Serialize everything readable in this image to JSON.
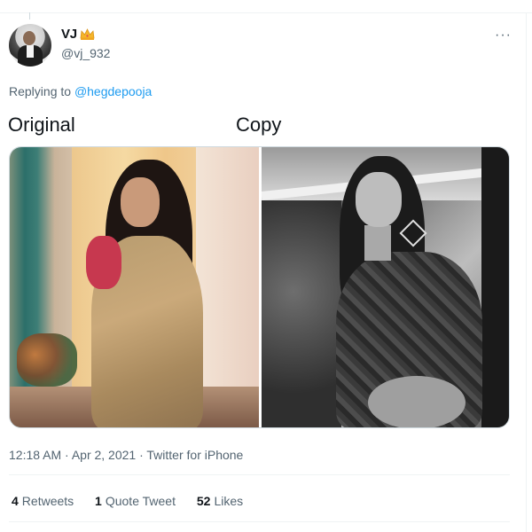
{
  "tweet": {
    "author": {
      "display_name": "VJ",
      "handle": "@vj_932",
      "badge_icon": "crown-emoji-icon"
    },
    "replying_prefix": "Replying to",
    "replying_to": "@hegdepooja",
    "labels": {
      "left": "Original",
      "right": "Copy"
    },
    "media": {
      "left_photo_icon": "woman-in-saree-photo",
      "right_photo_icon": "woman-black-and-white-photo"
    },
    "meta": "12:18 AM · Apr 2, 2021 · Twitter for iPhone",
    "stats": {
      "retweets_count": "4",
      "retweets_label": "Retweets",
      "quotes_count": "1",
      "quotes_label": "Quote Tweet",
      "likes_count": "52",
      "likes_label": "Likes"
    },
    "more_icon": "more-options-icon",
    "more_glyph": "···",
    "colors": {
      "link": "#1d9bf0",
      "secondary_text": "#536471",
      "primary_text": "#0f1419"
    }
  }
}
